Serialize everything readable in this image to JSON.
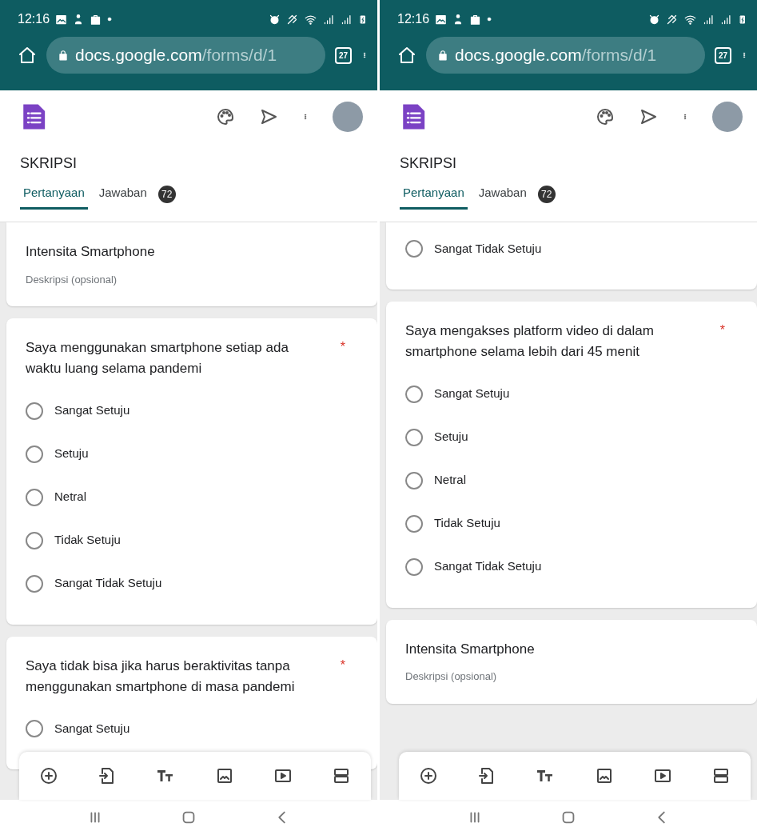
{
  "screens": [
    {
      "status_bar": {
        "time": "12:16"
      },
      "browser": {
        "url_host": "docs.google.com",
        "url_path": "/forms/d/1",
        "tab_count": "27"
      },
      "form": {
        "title": "SKRIPSI",
        "tabs": [
          {
            "label": "Pertanyaan",
            "selected": true
          },
          {
            "label": "Jawaban",
            "selected": false,
            "badge": "72"
          }
        ]
      },
      "cards": [
        {
          "kind": "section",
          "title": "Intensita Smartphone",
          "description": "Deskripsi (opsional)"
        },
        {
          "kind": "question",
          "text": "Saya menggunakan smartphone setiap ada waktu luang selama pandemi",
          "required_mark": "*",
          "options": [
            {
              "label": "Sangat Setuju",
              "selected": false
            },
            {
              "label": "Setuju",
              "selected": false
            },
            {
              "label": "Netral",
              "selected": false
            },
            {
              "label": "Tidak Setuju",
              "selected": false
            },
            {
              "label": "Sangat Tidak Setuju",
              "selected": false
            }
          ]
        },
        {
          "kind": "question",
          "text": "Saya tidak bisa jika harus beraktivitas tanpa menggunakan smartphone di masa pandemi",
          "required_mark": "*",
          "options": [
            {
              "label": "Sangat Setuju",
              "selected": false
            }
          ]
        }
      ]
    },
    {
      "status_bar": {
        "time": "12:16"
      },
      "browser": {
        "url_host": "docs.google.com",
        "url_path": "/forms/d/1",
        "tab_count": "27"
      },
      "form": {
        "title": "SKRIPSI",
        "tabs": [
          {
            "label": "Pertanyaan",
            "selected": true
          },
          {
            "label": "Jawaban",
            "selected": false,
            "badge": "72"
          }
        ]
      },
      "cards": [
        {
          "kind": "options",
          "options": [
            {
              "label": "Sangat Tidak Setuju",
              "selected": false
            }
          ]
        },
        {
          "kind": "question",
          "text": "Saya mengakses platform video di dalam smartphone selama lebih dari 45 menit",
          "required_mark": "*",
          "options": [
            {
              "label": "Sangat Setuju",
              "selected": false
            },
            {
              "label": "Setuju",
              "selected": false
            },
            {
              "label": "Netral",
              "selected": false
            },
            {
              "label": "Tidak Setuju",
              "selected": false
            },
            {
              "label": "Sangat Tidak Setuju",
              "selected": false
            }
          ]
        },
        {
          "kind": "section",
          "title": "Intensita Smartphone",
          "description": "Deskripsi (opsional)"
        }
      ]
    }
  ]
}
